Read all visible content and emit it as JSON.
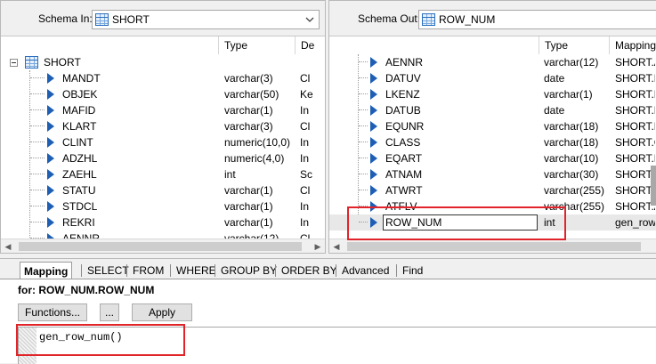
{
  "left_pane": {
    "schema_label": "Schema In:",
    "schema_value": "SHORT",
    "col_type": "Type",
    "col_desc": "De",
    "root": "SHORT",
    "rows": [
      {
        "name": "MANDT",
        "type": "varchar(3)",
        "desc": "Cl"
      },
      {
        "name": "OBJEK",
        "type": "varchar(50)",
        "desc": "Ke"
      },
      {
        "name": "MAFID",
        "type": "varchar(1)",
        "desc": "In"
      },
      {
        "name": "KLART",
        "type": "varchar(3)",
        "desc": "Cl"
      },
      {
        "name": "CLINT",
        "type": "numeric(10,0)",
        "desc": "In"
      },
      {
        "name": "ADZHL",
        "type": "numeric(4,0)",
        "desc": "In"
      },
      {
        "name": "ZAEHL",
        "type": "int",
        "desc": "Sc"
      },
      {
        "name": "STATU",
        "type": "varchar(1)",
        "desc": "Cl"
      },
      {
        "name": "STDCL",
        "type": "varchar(1)",
        "desc": "In"
      },
      {
        "name": "REKRI",
        "type": "varchar(1)",
        "desc": "In"
      },
      {
        "name": "AENNR",
        "type": "varchar(12)",
        "desc": "Cl"
      }
    ]
  },
  "right_pane": {
    "schema_label": "Schema Out:",
    "schema_value": "ROW_NUM",
    "col_type": "Type",
    "col_mapping": "Mapping",
    "rows": [
      {
        "name": "AENNR",
        "type": "varchar(12)",
        "mapping": "SHORT.A"
      },
      {
        "name": "DATUV",
        "type": "date",
        "mapping": "SHORT.D"
      },
      {
        "name": "LKENZ",
        "type": "varchar(1)",
        "mapping": "SHORT.LI"
      },
      {
        "name": "DATUB",
        "type": "date",
        "mapping": "SHORT.D"
      },
      {
        "name": "EQUNR",
        "type": "varchar(18)",
        "mapping": "SHORT.E"
      },
      {
        "name": "CLASS",
        "type": "varchar(18)",
        "mapping": "SHORT.C"
      },
      {
        "name": "EQART",
        "type": "varchar(10)",
        "mapping": "SHORT.E"
      },
      {
        "name": "ATNAM",
        "type": "varchar(30)",
        "mapping": "SHORT.A"
      },
      {
        "name": "ATWRT",
        "type": "varchar(255)",
        "mapping": "SHORT.A"
      },
      {
        "name": "ATFLV",
        "type": "varchar(255)",
        "mapping": "SHORT.A"
      },
      {
        "name": "ROW_NUM",
        "type": "int",
        "mapping": "gen_row_"
      }
    ]
  },
  "tabs": [
    {
      "label": "Mapping",
      "active": true
    },
    {
      "label": "SELECT"
    },
    {
      "label": "FROM"
    },
    {
      "label": "WHERE"
    },
    {
      "label": "GROUP BY"
    },
    {
      "label": "ORDER BY"
    },
    {
      "label": "Advanced"
    },
    {
      "label": "Find"
    }
  ],
  "editor": {
    "for_label": "for: ROW_NUM.ROW_NUM",
    "functions_button": "Functions...",
    "ellipsis_button": "...",
    "apply_button": "Apply",
    "code": "gen_row_num()"
  },
  "colors": {
    "highlight": "#e0242a",
    "arrow": "#1e5fb4"
  }
}
